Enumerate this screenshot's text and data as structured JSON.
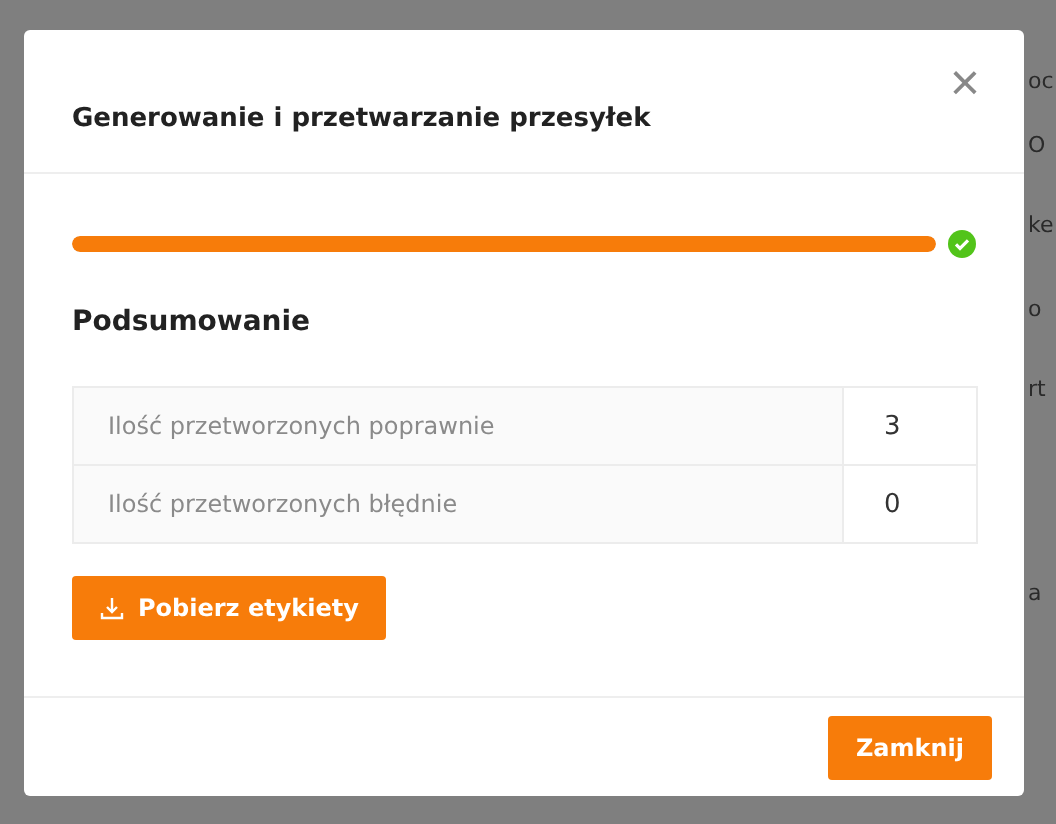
{
  "background": {
    "fragments": [
      "oc",
      "O",
      "ke",
      "o",
      "rt",
      "a"
    ]
  },
  "dialog": {
    "title": "Generowanie i przetwarzanie przesyłek",
    "close": "×",
    "progress": {
      "level": 1,
      "done": true
    },
    "section_title": "Podsumowanie",
    "summary": [
      {
        "label": "Ilość przetworzonych poprawnie",
        "value": "3"
      },
      {
        "label": "Ilość przetworzonych błędnie",
        "value": "0"
      }
    ],
    "download_button": "Pobierz etykiety",
    "footer_button": "Zamknij"
  }
}
